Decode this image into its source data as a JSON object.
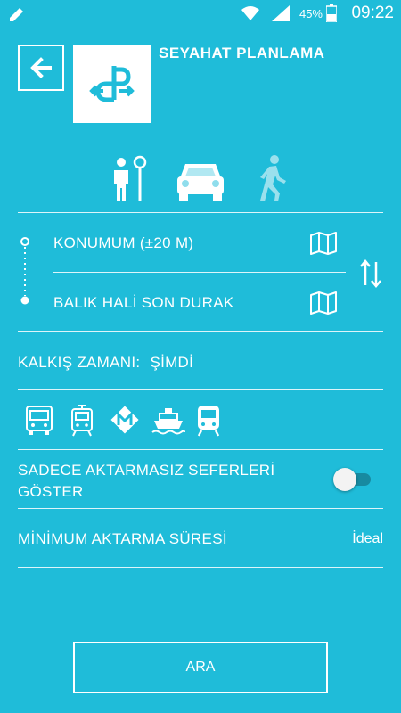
{
  "status_bar": {
    "battery_percent": "45%",
    "time": "09:22"
  },
  "header": {
    "title": "SEYAHAT PLANLAMA"
  },
  "route": {
    "origin": "KONUMUM (±20 M)",
    "destination": "BALIK HALİ SON DURAK"
  },
  "departure": {
    "label": "KALKIŞ ZAMANI:",
    "value": "ŞİMDİ"
  },
  "transit_modes": [
    "bus-icon",
    "tram-icon",
    "metro-icon",
    "ferry-icon",
    "train-icon"
  ],
  "options": {
    "direct_only_label": "SADECE AKTARMASIZ SEFERLERİ GÖSTER",
    "direct_only_enabled": false,
    "min_transfer_label": "MİNİMUM AKTARMA SÜRESİ",
    "min_transfer_value": "İdeal"
  },
  "actions": {
    "search_label": "ARA"
  },
  "colors": {
    "background": "#1fbcd9",
    "foreground": "#ffffff",
    "logo_accent": "#1fbcd9"
  }
}
